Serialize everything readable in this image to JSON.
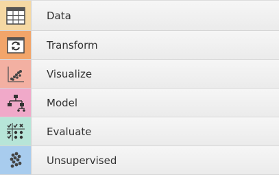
{
  "categories": [
    {
      "label": "Data",
      "icon": "table-icon"
    },
    {
      "label": "Transform",
      "icon": "transform-icon"
    },
    {
      "label": "Visualize",
      "icon": "scatter-plot-icon"
    },
    {
      "label": "Model",
      "icon": "tree-icon"
    },
    {
      "label": "Evaluate",
      "icon": "evaluate-matrix-icon"
    },
    {
      "label": "Unsupervised",
      "icon": "cluster-dots-icon"
    }
  ],
  "colors": {
    "data": "#f5d8a3",
    "transform": "#f2a56a",
    "visualize": "#f3b0a2",
    "model": "#f0a9c9",
    "evaluate": "#b7e5d8",
    "unsupervised": "#a8ccee"
  }
}
